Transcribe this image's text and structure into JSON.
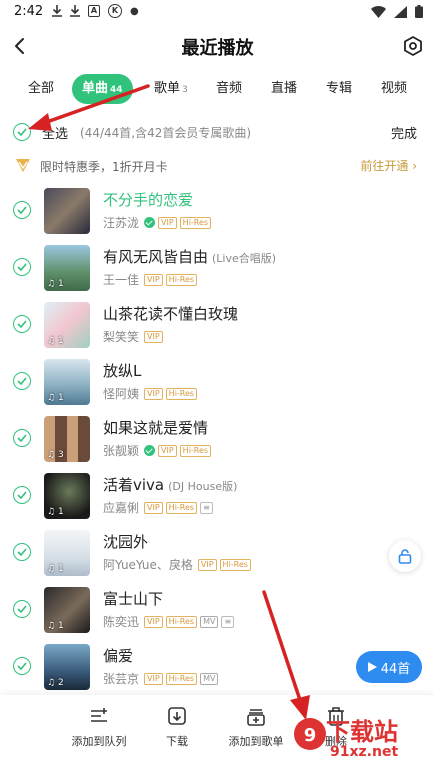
{
  "status_bar": {
    "time": "2:42",
    "icons": [
      "download-icon",
      "download-icon",
      "app-a-icon",
      "app-k-icon",
      "dot-icon",
      "wifi-icon",
      "signal-icon",
      "battery-icon"
    ]
  },
  "header": {
    "title": "最近播放"
  },
  "tabs": [
    {
      "label": "全部",
      "count": ""
    },
    {
      "label": "单曲",
      "count": "44"
    },
    {
      "label": "歌单",
      "count": "3"
    },
    {
      "label": "音频",
      "count": ""
    },
    {
      "label": "直播",
      "count": ""
    },
    {
      "label": "专辑",
      "count": ""
    },
    {
      "label": "视频",
      "count": ""
    }
  ],
  "select_all": {
    "label": "全选",
    "summary": "(44/44首,含42首会员专属歌曲)",
    "done": "完成"
  },
  "promo": {
    "text": "限时特惠季，1折开月卡",
    "action": "前往开通 ›"
  },
  "songs": [
    {
      "title": "不分手的恋爱",
      "version": "",
      "artist": "汪苏泷",
      "verified": true,
      "badges": [
        "VIP",
        "Hi-Res"
      ],
      "plays": "",
      "playing": true
    },
    {
      "title": "有风无风皆自由",
      "version": "(Live合唱版)",
      "artist": "王一佳",
      "verified": false,
      "badges": [
        "VIP",
        "Hi-Res"
      ],
      "plays": "1",
      "playing": false
    },
    {
      "title": "山茶花读不懂白玫瑰",
      "version": "",
      "artist": "梨笑笑",
      "verified": false,
      "badges": [
        "VIP"
      ],
      "plays": "1",
      "playing": false
    },
    {
      "title": "放纵L",
      "version": "",
      "artist": "怪阿姨",
      "verified": false,
      "badges": [
        "VIP",
        "Hi-Res"
      ],
      "plays": "1",
      "playing": false
    },
    {
      "title": "如果这就是爱情",
      "version": "",
      "artist": "张靓颖",
      "verified": true,
      "badges": [
        "VIP",
        "Hi-Res"
      ],
      "plays": "3",
      "playing": false
    },
    {
      "title": "活着viva",
      "version": "(DJ House版)",
      "artist": "应嘉俐",
      "verified": false,
      "badges": [
        "VIP",
        "Hi-Res",
        "≡"
      ],
      "plays": "1",
      "playing": false
    },
    {
      "title": "沈园外",
      "version": "",
      "artist": "阿YueYue、戾格",
      "verified": false,
      "badges": [
        "VIP",
        "Hi-Res"
      ],
      "plays": "1",
      "playing": false
    },
    {
      "title": "富士山下",
      "version": "",
      "artist": "陈奕迅",
      "verified": false,
      "badges": [
        "VIP",
        "Hi-Res",
        "MV",
        "≡"
      ],
      "plays": "1",
      "playing": false
    },
    {
      "title": "偏爱",
      "version": "",
      "artist": "张芸京",
      "verified": false,
      "badges": [
        "VIP",
        "Hi-Res",
        "MV"
      ],
      "plays": "2",
      "playing": false
    }
  ],
  "play_all": {
    "label": "44首"
  },
  "bottom_bar": [
    {
      "label": "添加到队列",
      "icon": "queue-add-icon"
    },
    {
      "label": "下载",
      "icon": "download-icon"
    },
    {
      "label": "添加到歌单",
      "icon": "playlist-add-icon"
    },
    {
      "label": "删除",
      "icon": "trash-icon"
    }
  ],
  "watermark": {
    "line1": "下载站",
    "line2": "91xz.net"
  },
  "colors": {
    "accent": "#31c27c",
    "play_all": "#2e8cf0",
    "vip_gold": "#d59a3e",
    "arrow": "#d62222"
  }
}
